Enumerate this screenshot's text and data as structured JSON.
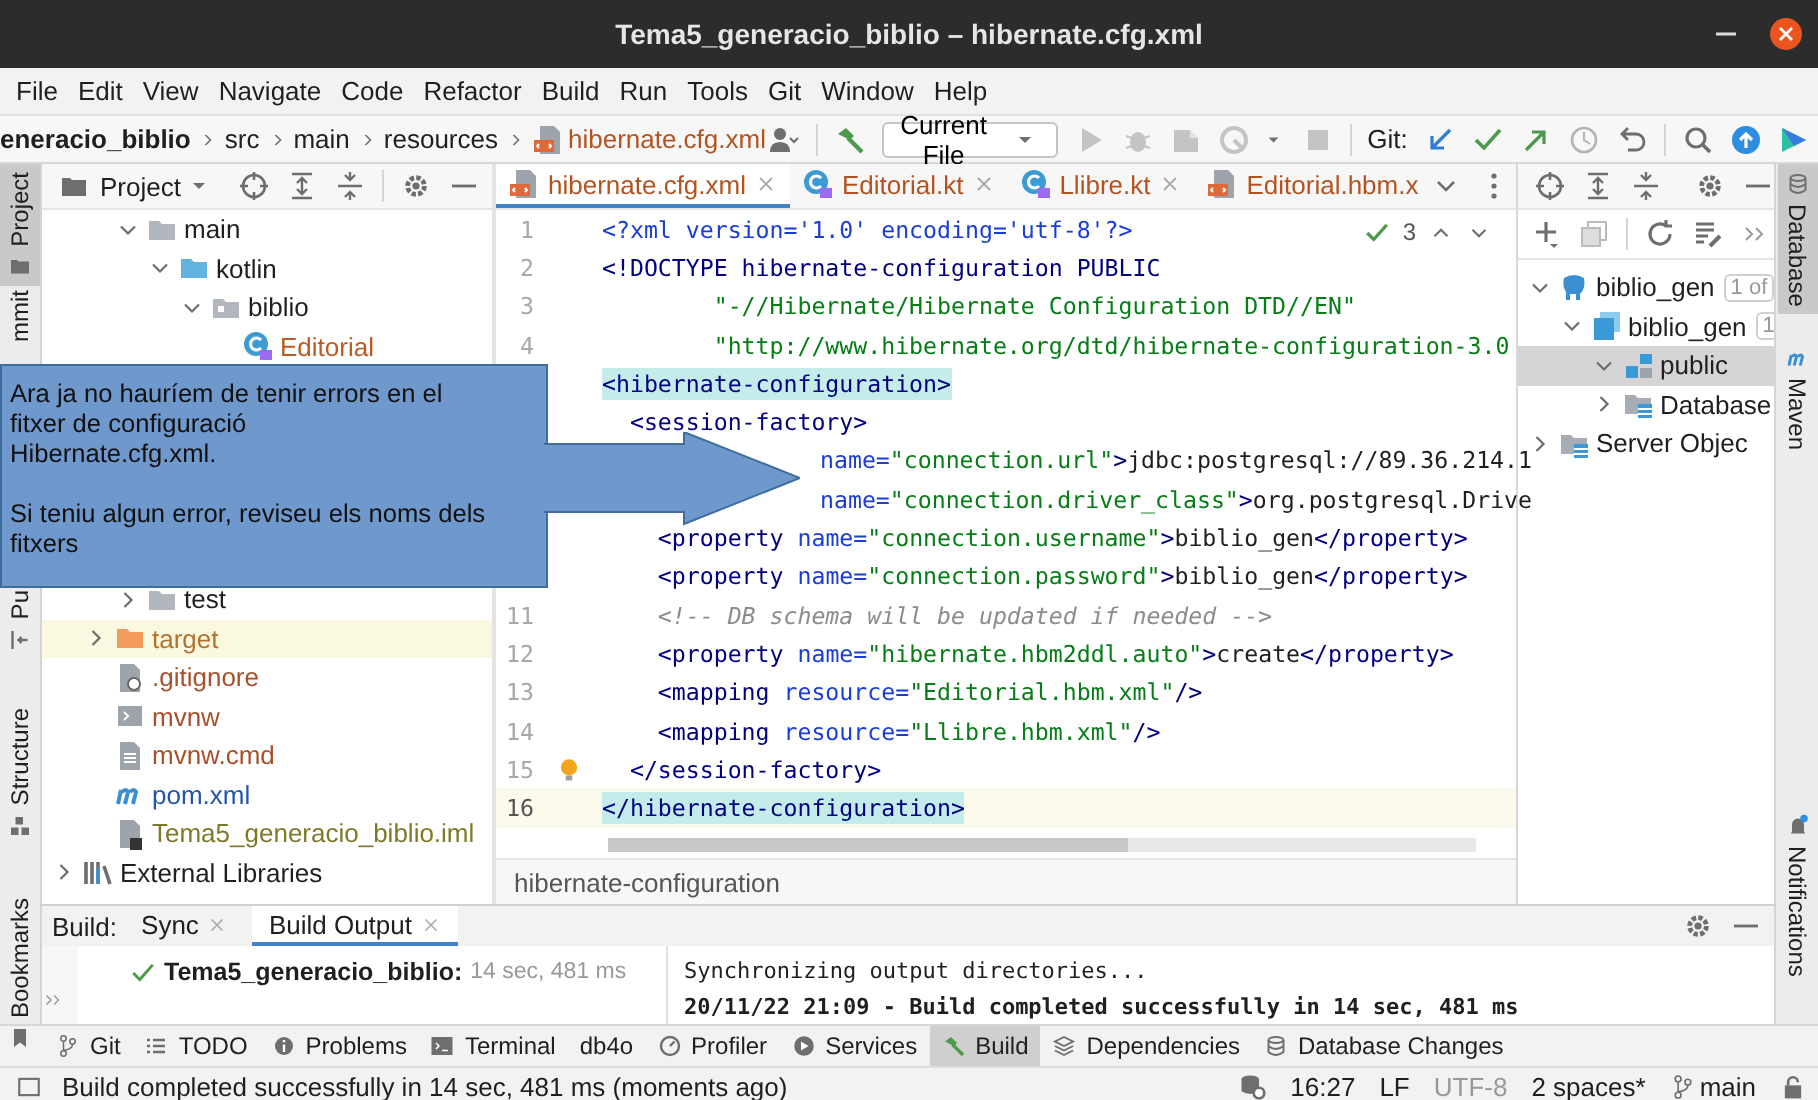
{
  "window": {
    "title": "Tema5_generacio_biblio – hibernate.cfg.xml"
  },
  "menu": [
    "File",
    "Edit",
    "View",
    "Navigate",
    "Code",
    "Refactor",
    "Build",
    "Run",
    "Tools",
    "Git",
    "Window",
    "Help"
  ],
  "breadcrumbs": [
    {
      "label": "eneracio_biblio",
      "kind": "project"
    },
    {
      "label": "src",
      "kind": "folder"
    },
    {
      "label": "main",
      "kind": "folder"
    },
    {
      "label": "resources",
      "kind": "folder"
    },
    {
      "label": "hibernate.cfg.xml",
      "kind": "xml-file"
    }
  ],
  "toolbar": {
    "run_config": "Current File",
    "git_label": "Git:"
  },
  "left_stripe": [
    {
      "label": "Project",
      "selected": true
    },
    {
      "label": "mmit",
      "selected": false
    },
    {
      "label": "Pu",
      "selected": false
    },
    {
      "label": "Structure",
      "selected": false
    },
    {
      "label": "Bookmarks",
      "selected": false
    }
  ],
  "project_panel": {
    "title": "Project",
    "tree": [
      {
        "children": [
          {
            "children": [
              {
                "label": "main",
                "kind": "folder",
                "expanded": true,
                "excluded": false,
                "color": "#1f1f1f",
                "children": [
                  {
                    "label": "kotlin",
                    "kind": "source-folder",
                    "expanded": true,
                    "excluded": false,
                    "color": "#1f1f1f",
                    "children": [
                      {
                        "label": "biblio",
                        "kind": "package",
                        "expanded": true,
                        "excluded": false,
                        "color": "#1f1f1f",
                        "children": [
                          {
                            "label": "Editorial",
                            "kind": "kotlin-class",
                            "excluded": false,
                            "color": "#bb5a22"
                          }
                        ]
                      }
                    ]
                  }
                ]
              },
              {
                "label": "test",
                "kind": "folder",
                "expanded": false,
                "excluded": false,
                "color": "#1f1f1f",
                "below_note": true
              }
            ]
          },
          {
            "label": "target",
            "kind": "excluded-folder",
            "expanded": false,
            "excluded": true,
            "color": "#b5712e"
          },
          {
            "label": ".gitignore",
            "kind": "ignore-file",
            "excluded": false,
            "color": "#a8502c"
          },
          {
            "label": "mvnw",
            "kind": "script-file",
            "excluded": false,
            "color": "#a8502c"
          },
          {
            "label": "mvnw.cmd",
            "kind": "text-file",
            "excluded": false,
            "color": "#a8502c"
          },
          {
            "label": "pom.xml",
            "kind": "maven",
            "excluded": false,
            "color": "#2356a8"
          },
          {
            "label": "Tema5_generacio_biblio.iml",
            "kind": "module-file",
            "excluded": false,
            "color": "#7f7a2a"
          }
        ]
      },
      {
        "label": "External Libraries",
        "kind": "library",
        "expanded": false,
        "excluded": false,
        "color": "#1f1f1f"
      }
    ]
  },
  "editor": {
    "tabs": [
      {
        "label": "hibernate.cfg.xml",
        "kind": "xml",
        "selected": true,
        "closable": true
      },
      {
        "label": "Editorial.kt",
        "kind": "kotlin",
        "selected": false,
        "closable": true
      },
      {
        "label": "Llibre.kt",
        "kind": "kotlin",
        "selected": false,
        "closable": true
      },
      {
        "label": "Editorial.hbm.x",
        "kind": "xml",
        "selected": false,
        "closable": false
      }
    ],
    "inspection_count": "3",
    "lines": [
      {
        "number": "1",
        "current": false,
        "highlighted": false,
        "bulb": false,
        "tokens": [
          {
            "kind": "attr",
            "text": "<?xml version='1.0' encoding='utf-8'?>"
          }
        ]
      },
      {
        "number": "2",
        "current": false,
        "highlighted": false,
        "bulb": false,
        "tokens": [
          {
            "kind": "tag",
            "text": "<!DOCTYPE hibernate-configuration PUBLIC"
          }
        ]
      },
      {
        "number": "3",
        "current": false,
        "highlighted": false,
        "bulb": false,
        "tokens": [
          {
            "kind": "value",
            "text": "        \"-//Hibernate/Hibernate Configuration DTD//EN\""
          }
        ]
      },
      {
        "number": "4",
        "current": false,
        "highlighted": false,
        "bulb": false,
        "tokens": [
          {
            "kind": "value",
            "text": "        \"http://www.hibernate.org/dtd/hibernate-configuration-3.0"
          }
        ]
      },
      {
        "current": false,
        "highlighted": true,
        "bulb": false,
        "tokens": [
          {
            "kind": "tag",
            "text": "<hibernate-configuration>"
          }
        ]
      },
      {
        "current": false,
        "highlighted": false,
        "bulb": false,
        "tokens": [
          {
            "kind": "tag",
            "text": "  <session-factory>"
          }
        ]
      },
      {
        "current": false,
        "highlighted": false,
        "bulb": false,
        "covered": true,
        "tokens": [
          {
            "kind": "attr",
            "text": "name="
          },
          {
            "kind": "value",
            "text": "\"connection.url\""
          },
          {
            "kind": "tag",
            "text": ">"
          },
          {
            "kind": "text",
            "text": "jdbc:postgresql://89.36.214.1"
          }
        ]
      },
      {
        "current": false,
        "highlighted": false,
        "bulb": false,
        "covered": true,
        "tokens": [
          {
            "kind": "attr",
            "text": "name="
          },
          {
            "kind": "value",
            "text": "\"connection.driver_class\""
          },
          {
            "kind": "tag",
            "text": ">"
          },
          {
            "kind": "text",
            "text": "org.postgresql.Drive"
          }
        ]
      },
      {
        "current": false,
        "highlighted": false,
        "bulb": false,
        "tokens": [
          {
            "kind": "tag",
            "text": "    <property"
          },
          {
            "kind": "attr",
            "text": " name="
          },
          {
            "kind": "value",
            "text": "\"connection.username\""
          },
          {
            "kind": "tag",
            "text": ">"
          },
          {
            "kind": "text",
            "text": "biblio_gen"
          },
          {
            "kind": "tag",
            "text": "</property>"
          }
        ]
      },
      {
        "current": false,
        "highlighted": false,
        "bulb": false,
        "tokens": [
          {
            "kind": "tag",
            "text": "    <property"
          },
          {
            "kind": "attr",
            "text": " name="
          },
          {
            "kind": "value",
            "text": "\"connection.password\""
          },
          {
            "kind": "tag",
            "text": ">"
          },
          {
            "kind": "text",
            "text": "biblio_gen"
          },
          {
            "kind": "tag",
            "text": "</property>"
          }
        ]
      },
      {
        "number": "11",
        "current": false,
        "highlighted": false,
        "bulb": false,
        "tokens": [
          {
            "kind": "comment",
            "text": "    <!-- DB schema will be updated if needed -->"
          }
        ]
      },
      {
        "number": "12",
        "current": false,
        "highlighted": false,
        "bulb": false,
        "tokens": [
          {
            "kind": "tag",
            "text": "    <property"
          },
          {
            "kind": "attr",
            "text": " name="
          },
          {
            "kind": "value",
            "text": "\"hibernate.hbm2ddl.auto\""
          },
          {
            "kind": "tag",
            "text": ">"
          },
          {
            "kind": "text",
            "text": "create"
          },
          {
            "kind": "tag",
            "text": "</property>"
          }
        ]
      },
      {
        "number": "13",
        "current": false,
        "highlighted": false,
        "bulb": false,
        "tokens": [
          {
            "kind": "tag",
            "text": "    <mapping"
          },
          {
            "kind": "attr",
            "text": " resource="
          },
          {
            "kind": "value",
            "text": "\"Editorial.hbm.xml\""
          },
          {
            "kind": "tag",
            "text": "/>"
          }
        ]
      },
      {
        "number": "14",
        "current": false,
        "highlighted": false,
        "bulb": false,
        "tokens": [
          {
            "kind": "tag",
            "text": "    <mapping"
          },
          {
            "kind": "attr",
            "text": " resource="
          },
          {
            "kind": "value",
            "text": "\"Llibre.hbm.xml\""
          },
          {
            "kind": "tag",
            "text": "/>"
          }
        ]
      },
      {
        "number": "15",
        "current": false,
        "highlighted": false,
        "bulb": true,
        "tokens": [
          {
            "kind": "tag",
            "text": "  </session-factory>"
          }
        ]
      },
      {
        "number": "16",
        "current": true,
        "highlighted": true,
        "bulb": false,
        "tokens": [
          {
            "kind": "tag",
            "text": "</hibernate-configuration>"
          }
        ]
      }
    ],
    "breadcrumb": "hibernate-configuration"
  },
  "database_panel": {
    "tree": [
      {
        "label": "biblio_gen",
        "kind": "postgres",
        "badge": "1 of",
        "expanded": true,
        "selected": false,
        "children": [
          {
            "label": "biblio_gen",
            "kind": "database",
            "badge": "1",
            "expanded": true,
            "selected": false,
            "children": [
              {
                "label": "public",
                "kind": "schema",
                "expanded": true,
                "selected": true
              },
              {
                "label": "Database",
                "kind": "table-folder",
                "expanded": false,
                "selected": false
              }
            ]
          }
        ]
      },
      {
        "label": "Server Objec",
        "kind": "table-folder",
        "expanded": false,
        "selected": false
      }
    ]
  },
  "right_stripe": [
    {
      "label": "Database",
      "selected": true
    },
    {
      "label": "Maven",
      "selected": false
    },
    {
      "label": "Notifications",
      "selected": false
    }
  ],
  "callout": {
    "paragraphs": [
      "Ara ja no hauríem de tenir errors en el\nfitxer de configuració\nHibernate.cfg.xml.",
      "Si teniu algun error, reviseu els noms dels\nfitxers"
    ]
  },
  "build_panel": {
    "title": "Build:",
    "tabs": [
      {
        "label": "Sync",
        "selected": false
      },
      {
        "label": "Build Output",
        "selected": true
      }
    ],
    "result": {
      "label": "Tema5_generacio_biblio:",
      "time": "14 sec, 481 ms"
    },
    "console": [
      {
        "text": "Synchronizing output directories...",
        "bold": false
      },
      {
        "text": "20/11/22 21:09 - Build completed successfully in 14 sec, 481 ms",
        "bold": true
      }
    ]
  },
  "tool_windows": [
    {
      "label": "Git",
      "kind": "branch",
      "selected": false
    },
    {
      "label": "TODO",
      "kind": "list",
      "selected": false
    },
    {
      "label": "Problems",
      "kind": "info",
      "selected": false
    },
    {
      "label": "Terminal",
      "kind": "terminal",
      "selected": false
    },
    {
      "label": "db4o",
      "selected": false
    },
    {
      "label": "Profiler",
      "kind": "gauge",
      "selected": false
    },
    {
      "label": "Services",
      "kind": "play-circle",
      "selected": false
    },
    {
      "label": "Build",
      "kind": "hammer",
      "selected": true
    },
    {
      "label": "Dependencies",
      "kind": "layers",
      "selected": false
    },
    {
      "label": "Database Changes",
      "kind": "database",
      "selected": false
    }
  ],
  "status_bar": {
    "message": "Build completed successfully in 14 sec, 481 ms (moments ago)",
    "position": "16:27",
    "line_separator": "LF",
    "encoding": "UTF-8",
    "indent": "2 spaces*",
    "branch": "main"
  }
}
